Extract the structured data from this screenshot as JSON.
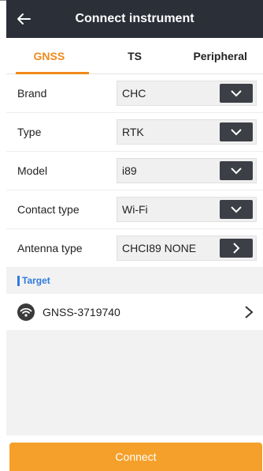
{
  "header": {
    "title": "Connect instrument",
    "back_icon": "arrow-left-icon"
  },
  "tabs": [
    {
      "label": "GNSS",
      "active": true
    },
    {
      "label": "TS",
      "active": false
    },
    {
      "label": "Peripheral",
      "active": false
    }
  ],
  "form": {
    "brand": {
      "label": "Brand",
      "value": "CHC",
      "control": "dropdown"
    },
    "type": {
      "label": "Type",
      "value": "RTK",
      "control": "dropdown"
    },
    "model": {
      "label": "Model",
      "value": "i89",
      "control": "dropdown"
    },
    "contact_type": {
      "label": "Contact type",
      "value": "Wi-Fi",
      "control": "dropdown"
    },
    "antenna_type": {
      "label": "Antenna type",
      "value": "CHCI89 NONE",
      "control": "navigate"
    }
  },
  "target": {
    "section_title": "Target",
    "device_name": "GNSS-3719740",
    "device_icon": "wifi-icon"
  },
  "footer": {
    "connect_label": "Connect"
  },
  "colors": {
    "header_bg": "#2b2f38",
    "accent": "#f08a1c",
    "button_bg": "#f5a02a",
    "section_accent": "#2f7bdc",
    "control_btn": "#3c3f45"
  }
}
